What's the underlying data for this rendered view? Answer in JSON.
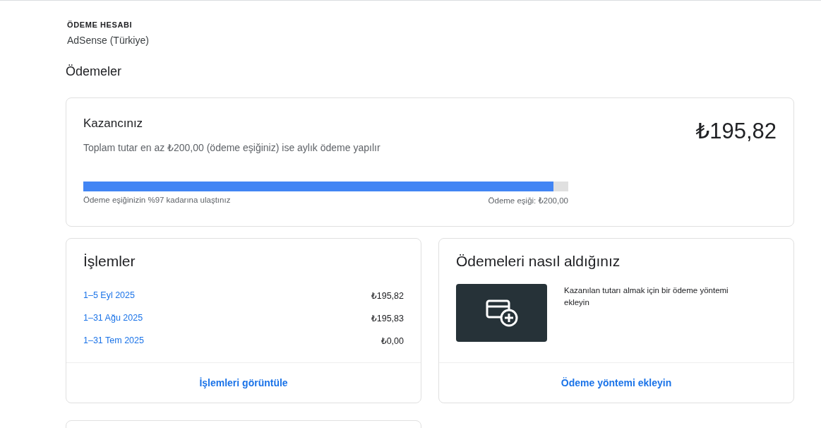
{
  "account": {
    "label": "ÖDEME HESABI",
    "name": "AdSense (Türkiye)"
  },
  "section_title": "Ödemeler",
  "earnings": {
    "title": "Kazancınız",
    "amount": "₺195,82",
    "description": "Toplam tutar en az ₺200,00 (ödeme eşiğiniz) ise aylık ödeme yapılır",
    "level": 0.97,
    "progress_text": "Ödeme eşiğinizin %97 kadarına ulaştınız",
    "threshold_text": "Ödeme eşiği: ₺200,00"
  },
  "transactions": {
    "title": "İşlemler",
    "rows": [
      {
        "period": "1–5 Eyl 2025",
        "amount": "₺195,82"
      },
      {
        "period": "1–31 Ağu 2025",
        "amount": "₺195,83"
      },
      {
        "period": "1–31 Tem 2025",
        "amount": "₺0,00"
      }
    ],
    "action": "İşlemleri görüntüle"
  },
  "payment_method": {
    "title": "Ödemeleri nasıl aldığınız",
    "description": "Kazanılan tutarı almak için bir ödeme yöntemi ekleyin",
    "action": "Ödeme yöntemi ekleyin"
  }
}
